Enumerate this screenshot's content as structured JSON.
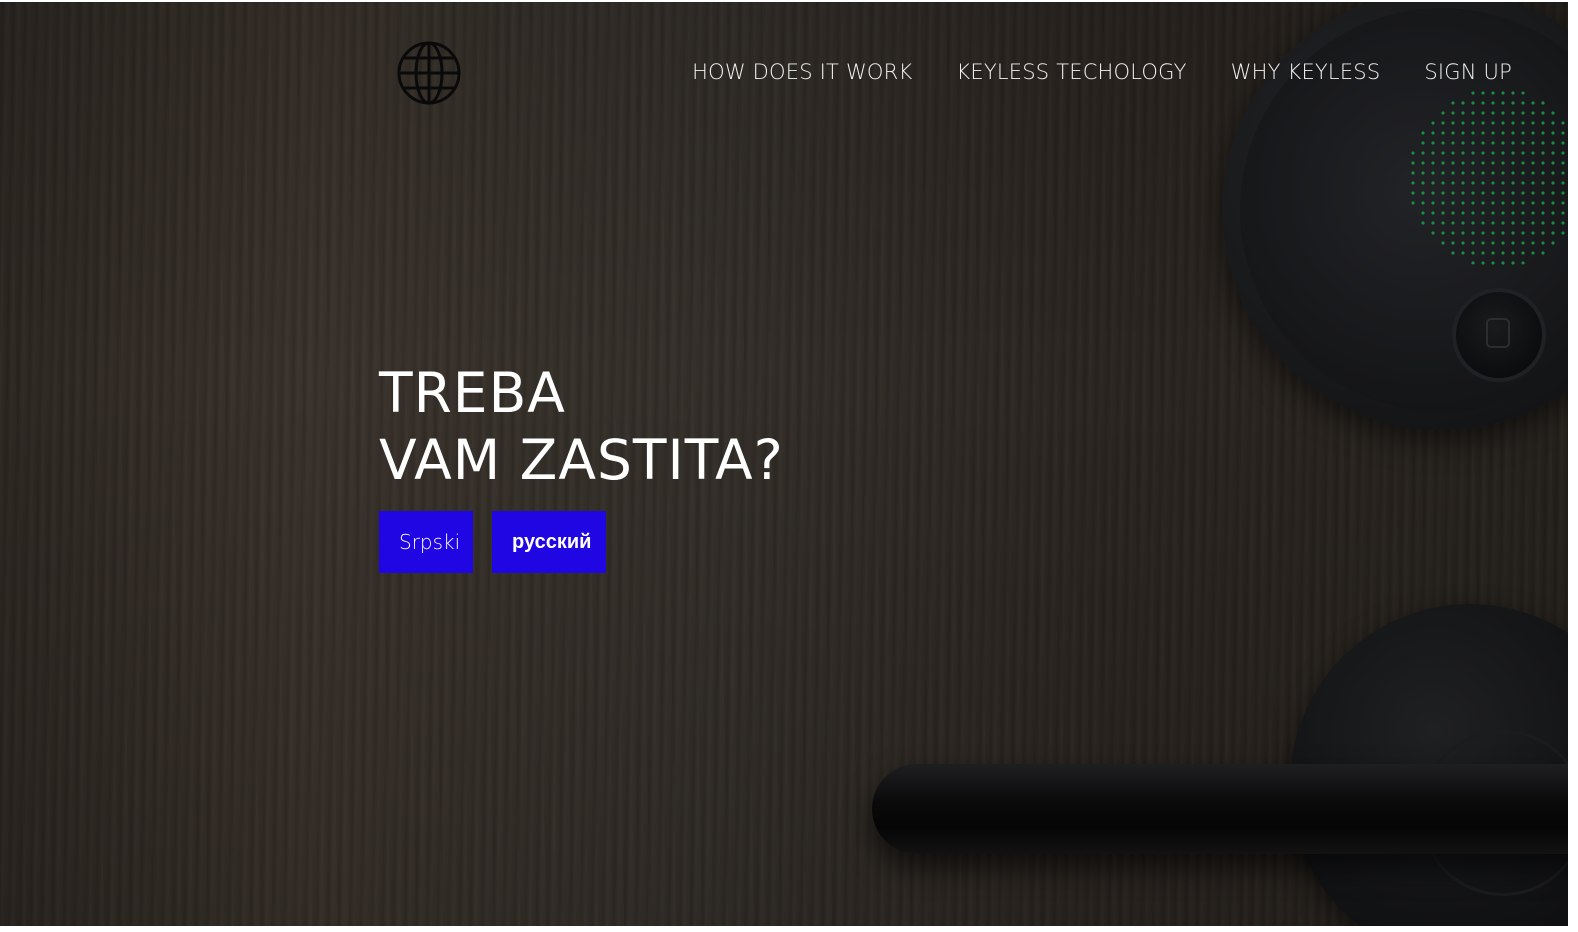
{
  "nav": {
    "items": [
      {
        "label": "HOW DOES IT WORK"
      },
      {
        "label": "KEYLESS TECHOLOGY"
      },
      {
        "label": "WHY KEYLESS"
      },
      {
        "label": "SIGN UP"
      }
    ]
  },
  "hero": {
    "title_line1": "TREBA",
    "title_line2": "VAM ZASTITA?",
    "buttons": [
      {
        "label": "Srpski"
      },
      {
        "label": "русский"
      }
    ]
  },
  "icons": {
    "logo": "globe-icon"
  },
  "colors": {
    "button_bg": "#2006e3",
    "text": "#ffffff",
    "led": "#1aa24a"
  }
}
